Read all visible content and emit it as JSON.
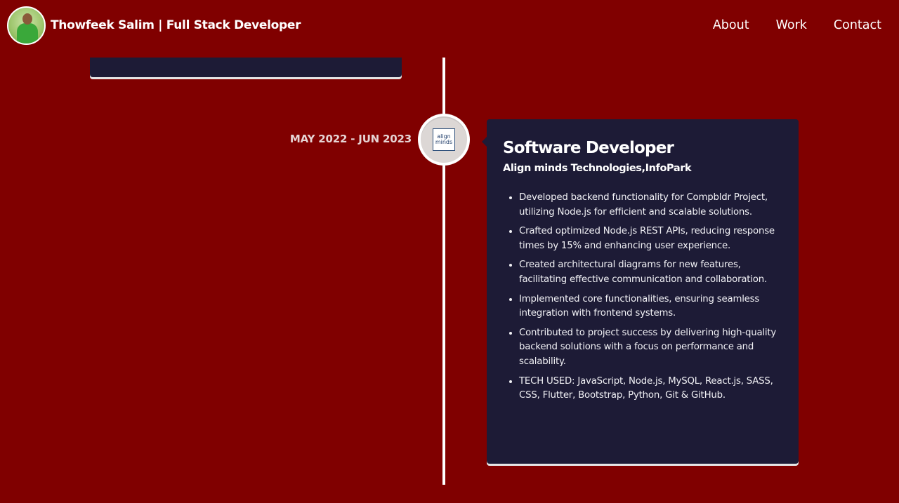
{
  "header": {
    "brand_name": "Thowfeek Salim  | Full Stack Developer",
    "avatar_icon": "profile-photo",
    "nav": [
      {
        "label": "About"
      },
      {
        "label": "Work"
      },
      {
        "label": "Contact"
      }
    ]
  },
  "colors": {
    "background": "#800000",
    "card": "#1d1b36",
    "text": "#ffffff"
  },
  "timeline": {
    "entry": {
      "date": "MAY 2022 - JUN 2023",
      "logo_line1": "align",
      "logo_line2": "minds",
      "title": "Software Developer",
      "company": "Align minds Technologies,InfoPark",
      "points": [
        "Developed backend functionality for Compbldr Project, utilizing Node.js for efficient and scalable solutions.",
        "Crafted optimized Node.js REST APIs, reducing response times by 15% and enhancing user experience.",
        "Created architectural diagrams for new features, facilitating effective communication and collaboration.",
        "Implemented core functionalities, ensuring seamless integration with frontend systems.",
        "Contributed to project success by delivering high-quality backend solutions with a focus on performance and scalability.",
        "TECH USED: JavaScript, Node.js, MySQL, React.js, SASS, CSS, Flutter, Bootstrap, Python, Git & GitHub."
      ]
    }
  }
}
